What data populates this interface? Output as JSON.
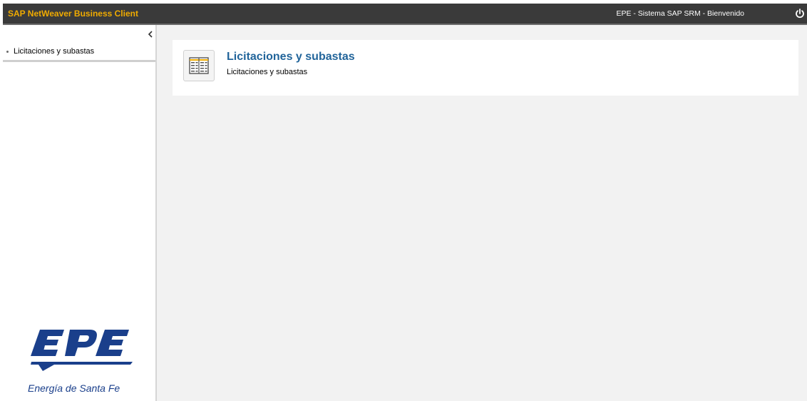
{
  "header": {
    "app_title": "SAP NetWeaver Business Client",
    "window_title": "EPE - Sistema SAP SRM - Bienvenido",
    "power_icon": "power-icon"
  },
  "sidebar": {
    "collapse_icon": "chevron-left-icon",
    "items": [
      {
        "label": "Licitaciones y subastas"
      }
    ],
    "logo": {
      "text": "EPE",
      "caption": "Energía de Santa Fe"
    }
  },
  "main": {
    "tile": {
      "title": "Licitaciones y subastas",
      "subtitle": "Licitaciones y subastas",
      "icon": "document-list-icon"
    }
  },
  "colors": {
    "header_bg": "#3a3a3a",
    "app_title": "#f0ab00",
    "tile_title": "#21649a",
    "logo_blue": "#1a3f8b"
  }
}
